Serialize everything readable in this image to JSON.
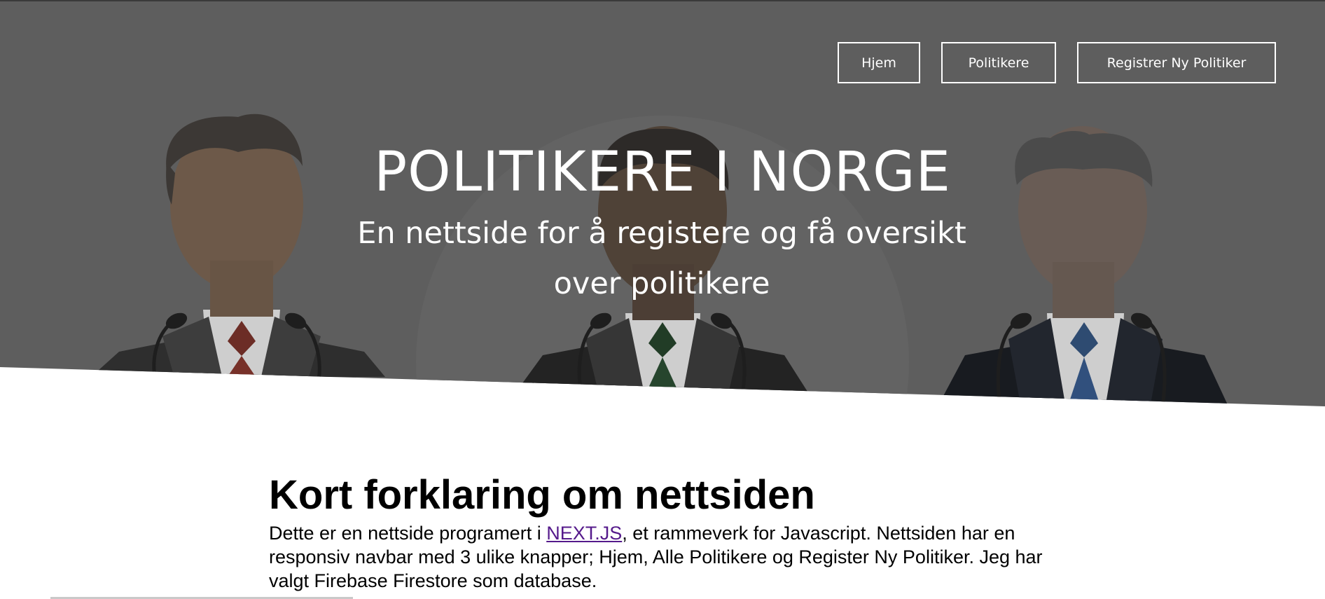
{
  "nav": {
    "home_label": "Hjem",
    "politicians_label": "Politikere",
    "register_label": "Registrer Ny Politiker"
  },
  "hero": {
    "title": "POLITIKERE I NORGE",
    "subtitle": "En nettside for å registere og få oversikt over politikere",
    "overlay_color": "#5f5f5f"
  },
  "content": {
    "heading": "Kort forklaring om nettsiden",
    "text_before_link": "Dette er en nettside programert i ",
    "link_text": "NEXT.JS",
    "text_after_link": ", et rammeverk for Javascript. Nettsiden har en responsiv navbar med 3 ulike knapper; Hjem, Alle Politikere og Register Ny Politiker. Jeg har valgt Firebase Firestore som database."
  },
  "colors": {
    "link": "#551a8b",
    "tie_left": "#6e2a22",
    "tie_middle": "#1d3a22",
    "tie_right": "#2b4a73"
  }
}
